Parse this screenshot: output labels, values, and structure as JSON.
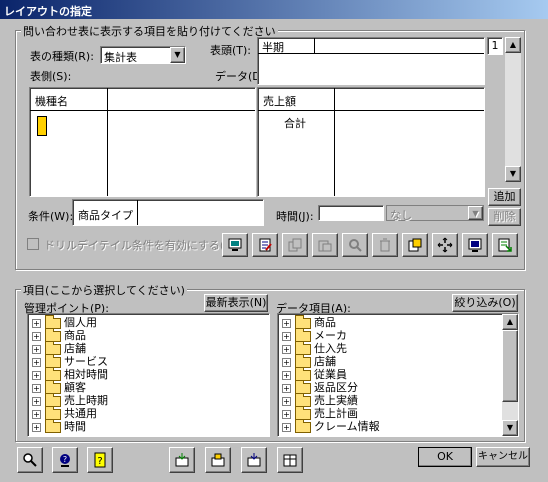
{
  "window": {
    "title": "レイアウトの指定"
  },
  "layout_group": {
    "legend": "問い合わせ表に表示する項目を貼り付けてください",
    "table_type_label": "表の種類(R):",
    "table_type_value": "集計表",
    "header_label": "表頭(T):",
    "header_value": "半期",
    "side_label": "表側(S):",
    "data_label": "データ(D):",
    "page_number": "1",
    "side_column_header": "機種名",
    "data_column_header": "売上額",
    "data_total_label": "合計",
    "condition_label": "条件(W):",
    "condition_value": "商品タイプ",
    "time_label": "時間(J):",
    "time_select_value": "なし",
    "add_button": "追加",
    "delete_button": "削除",
    "drill_checkbox_label": "ドリルデイテイル条件を有効にする(L)"
  },
  "items_group": {
    "legend": "項目(ここから選択してください)",
    "mgmt_label": "管理ポイント(P):",
    "refresh_button": "最新表示(N)",
    "data_items_label": "データ項目(A):",
    "filter_button": "絞り込み(O)",
    "mgmt_items": [
      "個人用",
      "商品",
      "店舗",
      "サービス",
      "相対時間",
      "顧客",
      "売上時期",
      "共通用",
      "時間"
    ],
    "data_items": [
      "商品",
      "メーカ",
      "仕入先",
      "店舗",
      "従業員",
      "返品区分",
      "売上実績",
      "売上計画",
      "クレーム情報"
    ]
  },
  "footer": {
    "ok_button": "OK",
    "cancel_button": "キャンセル"
  }
}
